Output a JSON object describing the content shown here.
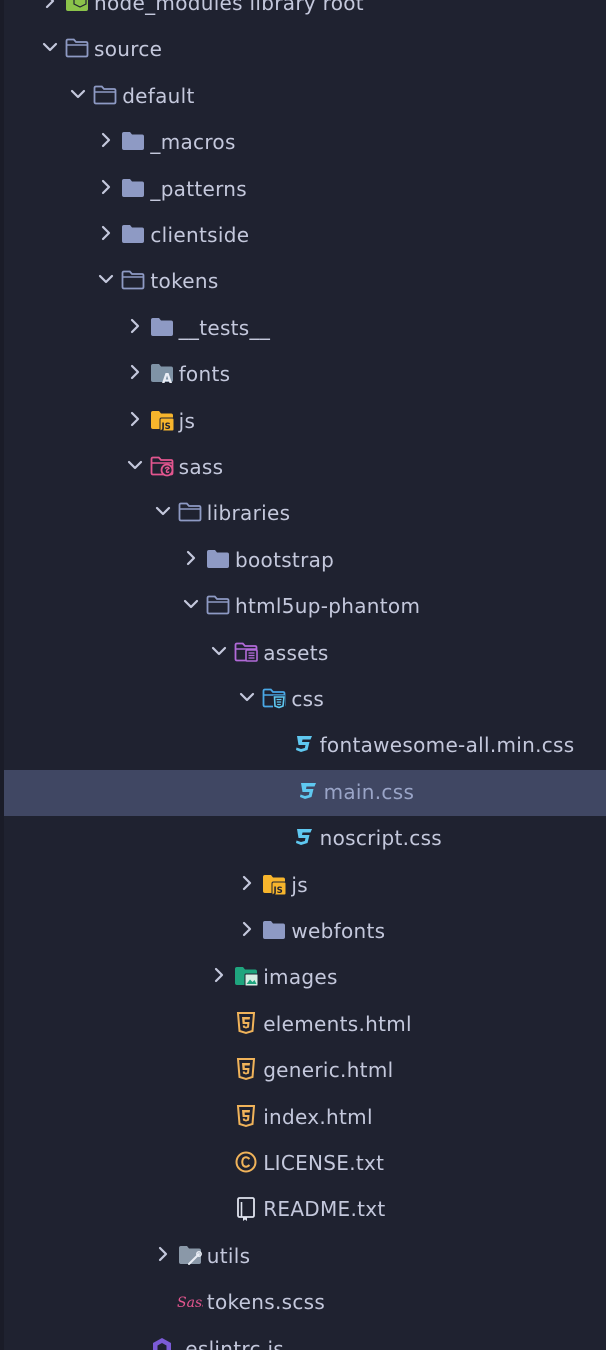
{
  "colors": {
    "background": "#1f2230",
    "selection": "#404763",
    "text": "#c4c8dc",
    "folder": "#8e9ac4",
    "css": "#5fc8f0",
    "html": "#f0b35a",
    "js": "#f7b52c",
    "sass": "#e3568f",
    "assets": "#b16ad8",
    "images": "#1fa57e"
  },
  "tree": {
    "items": [
      {
        "label": "node_modules  library root",
        "icon": "node-modules-folder-icon",
        "chevron": "right"
      },
      {
        "label": "source",
        "icon": "folder-open-icon",
        "chevron": "down"
      },
      {
        "label": "default",
        "icon": "folder-open-icon",
        "chevron": "down"
      },
      {
        "label": "_macros",
        "icon": "folder-icon",
        "chevron": "right"
      },
      {
        "label": "_patterns",
        "icon": "folder-icon",
        "chevron": "right"
      },
      {
        "label": "clientside",
        "icon": "folder-icon",
        "chevron": "right"
      },
      {
        "label": "tokens",
        "icon": "folder-open-icon",
        "chevron": "down"
      },
      {
        "label": "__tests__",
        "icon": "folder-icon",
        "chevron": "right"
      },
      {
        "label": "fonts",
        "icon": "fonts-folder-icon",
        "chevron": "right"
      },
      {
        "label": "js",
        "icon": "js-folder-icon",
        "chevron": "right"
      },
      {
        "label": "sass",
        "icon": "sass-folder-icon",
        "chevron": "down"
      },
      {
        "label": "libraries",
        "icon": "folder-open-icon",
        "chevron": "down"
      },
      {
        "label": "bootstrap",
        "icon": "folder-icon",
        "chevron": "right"
      },
      {
        "label": "html5up-phantom",
        "icon": "folder-open-icon",
        "chevron": "down"
      },
      {
        "label": "assets",
        "icon": "assets-folder-icon",
        "chevron": "down"
      },
      {
        "label": "css",
        "icon": "css-folder-icon",
        "chevron": "down"
      },
      {
        "label": "fontawesome-all.min.css",
        "icon": "css3-file-icon",
        "chevron": "none"
      },
      {
        "label": "main.css",
        "icon": "css3-file-icon",
        "chevron": "none",
        "selected": true
      },
      {
        "label": "noscript.css",
        "icon": "css3-file-icon",
        "chevron": "none"
      },
      {
        "label": "js",
        "icon": "js-folder-icon",
        "chevron": "right"
      },
      {
        "label": "webfonts",
        "icon": "folder-icon",
        "chevron": "right"
      },
      {
        "label": "images",
        "icon": "images-folder-icon",
        "chevron": "right"
      },
      {
        "label": "elements.html",
        "icon": "html5-file-icon",
        "chevron": "none"
      },
      {
        "label": "generic.html",
        "icon": "html5-file-icon",
        "chevron": "none"
      },
      {
        "label": "index.html",
        "icon": "html5-file-icon",
        "chevron": "none"
      },
      {
        "label": "LICENSE.txt",
        "icon": "license-file-icon",
        "chevron": "none"
      },
      {
        "label": "README.txt",
        "icon": "readme-file-icon",
        "chevron": "none"
      },
      {
        "label": "utils",
        "icon": "utils-folder-icon",
        "chevron": "right"
      },
      {
        "label": "tokens.scss",
        "icon": "sass-file-icon",
        "chevron": "none"
      },
      {
        "label": ".eslintrc.js",
        "icon": "eslint-file-icon",
        "chevron": "none"
      }
    ]
  }
}
